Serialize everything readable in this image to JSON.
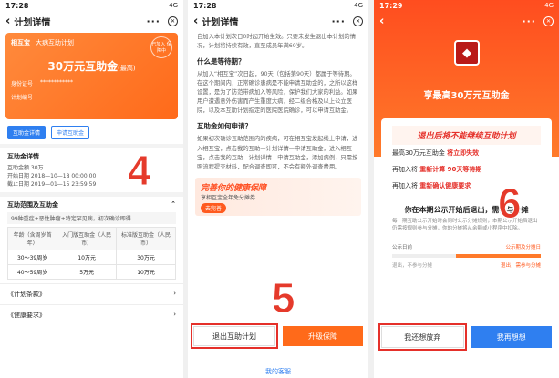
{
  "panel1": {
    "status": {
      "time": "17:28",
      "carrier": "搜索",
      "net": "4G"
    },
    "nav_title": "计划详情",
    "card": {
      "brand": "相互宝",
      "plan": "大病互助计划",
      "stamp": "已加入 保障中",
      "amount": "30万元互助金",
      "amount_note": "(最高)",
      "id_label": "身份证号",
      "plan_no_label": "计划编号"
    },
    "btn_detail": "互助金详情",
    "btn_apply": "申请互助金",
    "detail": {
      "title": "互助金详情",
      "line1": "互助金额 30万",
      "line2": "开始日期 2018—10—18 00:00:00",
      "line3": "截止日期 2019—01—15 23:59:59"
    },
    "scope": {
      "title": "互助范围及互助金",
      "tag": "99种重症+恶性肿瘤+特定罕见病，初次确诊即得",
      "headers": [
        "年龄（含周岁首年）",
        "入门版互助金（人民币）",
        "标准版互助金（人民币）"
      ],
      "rows": [
        [
          "30～39周岁",
          "10万元",
          "30万元"
        ],
        [
          "40～59周岁",
          "5万元",
          "10万元"
        ]
      ]
    },
    "terms": "《计划条款》",
    "health": "《健康要求》",
    "marker": "4"
  },
  "panel2": {
    "status": {
      "time": "17:28",
      "carrier": "搜索",
      "net": "4G"
    },
    "nav_title": "计划详情",
    "para0": "自加入本计划次日0时起开始生效。只要未发生退出本计划的情况，计划将持续有效，直至成员年满60岁。",
    "q1": "什么是等待期？",
    "a1": "从加入“相互宝”次日起，90天（包括第90天）都属于等待期。在这个期间内，正常确诊患病是不能申请互助金的，之所以这样设置，是为了防范带病加入等风险，保护我们大家的利益。如果用户遭遇意外伤害而产生重度大病，经二级合格及以上公立医院，以及本互助计划指定的医院医院确诊，可以申请互助金。",
    "q2": "互助金如何申请？",
    "a2": "如果初次确诊互助范围内的疾病，可在相互宝发起线上申请，进入相互宝，点击我的互助—计划详情—申请互助金，进入相互宝，点击我的互助—计划详情—申请互助金，添加病例，只需按照流程提交材料，配合调查即可，不会有额外调查费用。",
    "banner": {
      "title": "完善你的健康保障",
      "sub1": "享相互宝全年免分摊券",
      "sub2": "立返24期免分摊券",
      "go": "去完善"
    },
    "btn_exit": "退出互助计划",
    "btn_upgrade": "升级保障",
    "service": "我的客服",
    "marker": "5"
  },
  "panel3": {
    "status": {
      "time": "17:29",
      "carrier": "搜索",
      "net": "4G"
    },
    "headline": "享最高30万元互助金",
    "warning": "退出后将不能继续互助计划",
    "line1_pre": "最高30万元互助金",
    "line1_em": "将立即失效",
    "line2_pre": "再加入将",
    "line2_em": "重新计算 90天等待期",
    "line3_pre": "再加入将",
    "line3_em": "重新确认健康要求",
    "sub": "你在本期公示开始后退出，需参与分摊",
    "desc": "每一期互助公示开始时会同时公示分摊规则，本期公示开始后退出仍需按规则参与分摊，你的分摊将从余额或小程序中扣除。",
    "tl": {
      "left_top": "公示日前",
      "right_top": "公示期及分摊日",
      "left_bottom": "退出，不参与分摊",
      "right_bottom": "退出，需参与分摊"
    },
    "btn_give_up": "我还想放弃",
    "btn_think": "我再想想",
    "marker": "6"
  }
}
